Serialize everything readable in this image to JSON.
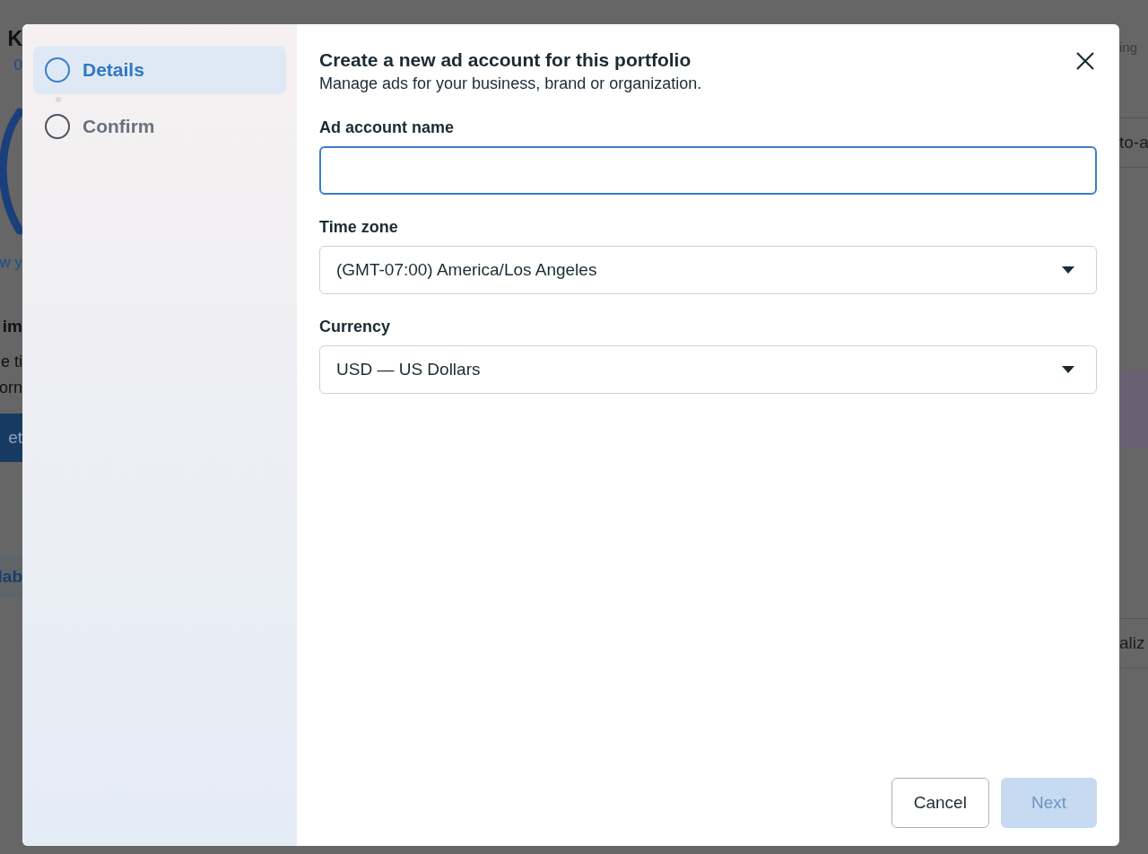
{
  "backdrop": {
    "left": [
      {
        "kind": "title",
        "text": "K"
      },
      {
        "kind": "link",
        "text": "0"
      },
      {
        "kind": "arc"
      },
      {
        "kind": "link",
        "text": "w y"
      },
      {
        "kind": "heading",
        "text": "im"
      },
      {
        "kind": "body",
        "text": "e ti"
      },
      {
        "kind": "body",
        "text": "orn"
      },
      {
        "kind": "button",
        "text": "et"
      },
      {
        "kind": "band",
        "text": "lab"
      }
    ],
    "right": [
      {
        "kind": "muted",
        "text": "ing"
      },
      {
        "kind": "row",
        "text": "to-a"
      },
      {
        "kind": "banner"
      },
      {
        "kind": "row",
        "text": "aliz"
      }
    ]
  },
  "steps": [
    {
      "label": "Details",
      "selected": true
    },
    {
      "label": "Confirm",
      "selected": false
    }
  ],
  "dialog": {
    "title": "Create a new ad account for this portfolio",
    "subtitle": "Manage ads for your business, brand or organization.",
    "fields": [
      {
        "kind": "text",
        "label": "Ad account name",
        "focused": true
      },
      {
        "kind": "select",
        "label": "Time zone",
        "value": "(GMT-07:00) America/Los Angeles"
      },
      {
        "kind": "select",
        "label": "Currency",
        "value": "USD — US Dollars"
      }
    ],
    "buttons": [
      {
        "label": "Cancel",
        "kind": "secondary",
        "disabled": false
      },
      {
        "label": "Next",
        "kind": "primary",
        "disabled": true
      }
    ]
  }
}
